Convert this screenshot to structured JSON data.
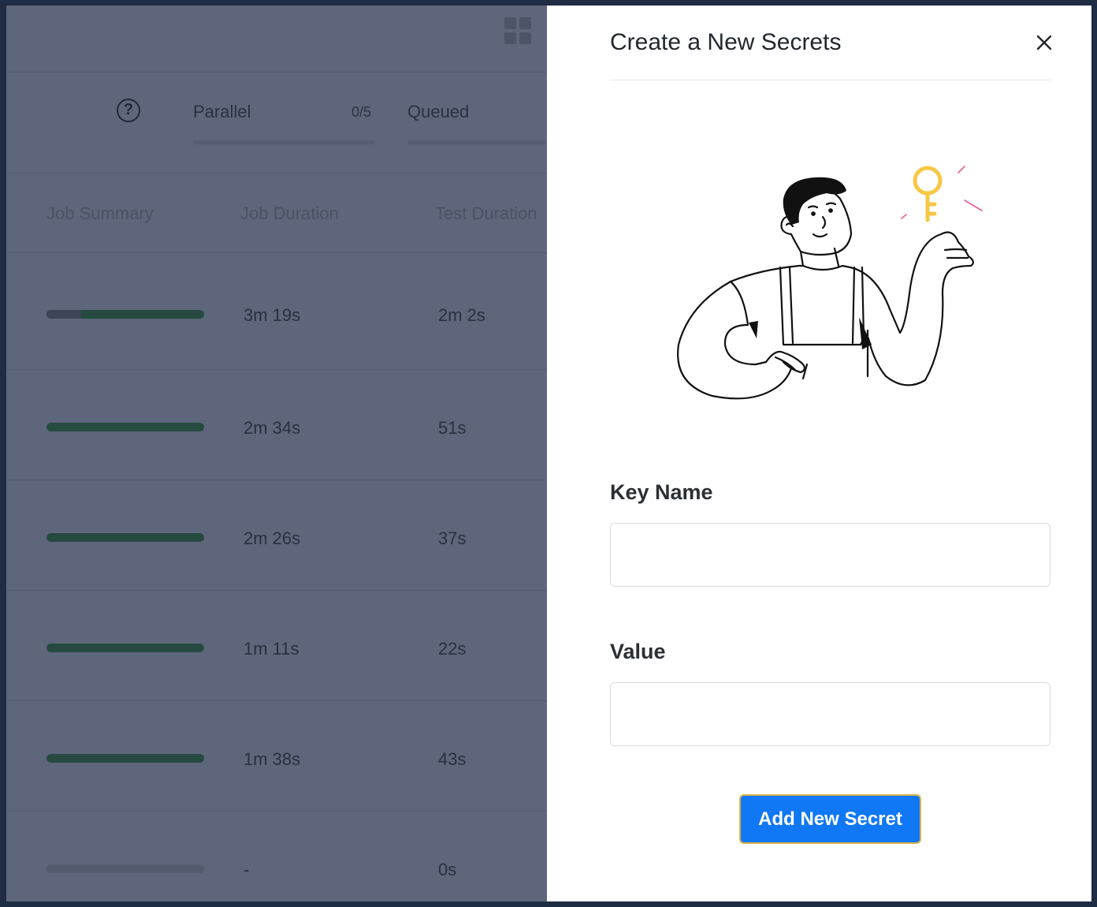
{
  "background": {
    "stats": {
      "parallel_label": "Parallel",
      "parallel_count": "0/5",
      "queued_label": "Queued"
    },
    "table": {
      "columns": [
        "Job Summary",
        "Job Duration",
        "Test Duration"
      ],
      "rows": [
        {
          "progress_grey_fraction": 0.22,
          "job_duration": "3m 19s",
          "test_duration": "2m 2s"
        },
        {
          "progress_grey_fraction": 0,
          "job_duration": "2m 34s",
          "test_duration": "51s"
        },
        {
          "progress_grey_fraction": 0,
          "job_duration": "2m 26s",
          "test_duration": "37s"
        },
        {
          "progress_grey_fraction": 0,
          "job_duration": "1m 11s",
          "test_duration": "22s"
        },
        {
          "progress_grey_fraction": 0,
          "job_duration": "1m 38s",
          "test_duration": "43s"
        },
        {
          "progress_grey_fraction": 1,
          "job_duration": "-",
          "test_duration": "0s"
        }
      ]
    }
  },
  "drawer": {
    "title": "Create a New Secrets",
    "key_label": "Key Name",
    "key_value": "",
    "value_label": "Value",
    "value_value": "",
    "submit_label": "Add New Secret",
    "close_icon": "close-icon",
    "illustration": "person-holding-key-illustration"
  },
  "colors": {
    "overlay": "#5d667a",
    "progress_green": "#264a40",
    "button_blue": "#1078f5",
    "key_yellow": "#f7c745",
    "spark_pink": "#ee5a9a"
  }
}
